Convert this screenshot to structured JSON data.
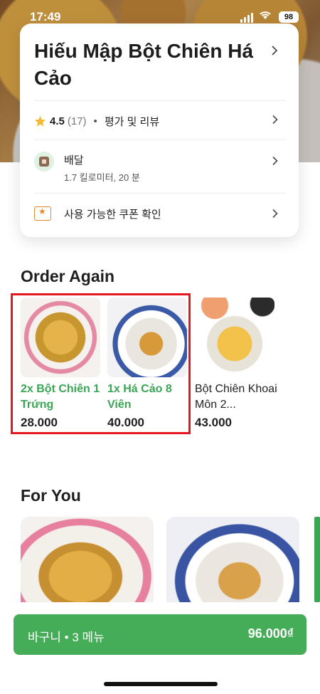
{
  "status_bar": {
    "time": "17:49",
    "battery": "98"
  },
  "store": {
    "name": "Hiếu Mập Bột Chiên Há Cảo",
    "rating": "4.5",
    "rating_count": "(17)",
    "reviews_label": "평가 및 리뷰",
    "delivery_label": "배달",
    "delivery_info": "1.7 킬로미터, 20 분",
    "coupon_label": "사용 가능한 쿠폰 확인"
  },
  "order_again": {
    "title": "Order Again",
    "items": [
      {
        "name": "2x Bột Chiên 1 Trứng",
        "price": "28.000"
      },
      {
        "name": "1x Há Cảo 8 Viên",
        "price": "40.000"
      },
      {
        "name": "Bột Chiên Khoai Môn 2...",
        "price": "43.000"
      }
    ]
  },
  "for_you": {
    "title": "For You"
  },
  "cart": {
    "label": "바구니 • 3 메뉴",
    "total": "96.000₫"
  },
  "colors": {
    "accent_green": "#45ad58",
    "highlight_red": "#e5161d",
    "star_yellow": "#f5b82e"
  }
}
